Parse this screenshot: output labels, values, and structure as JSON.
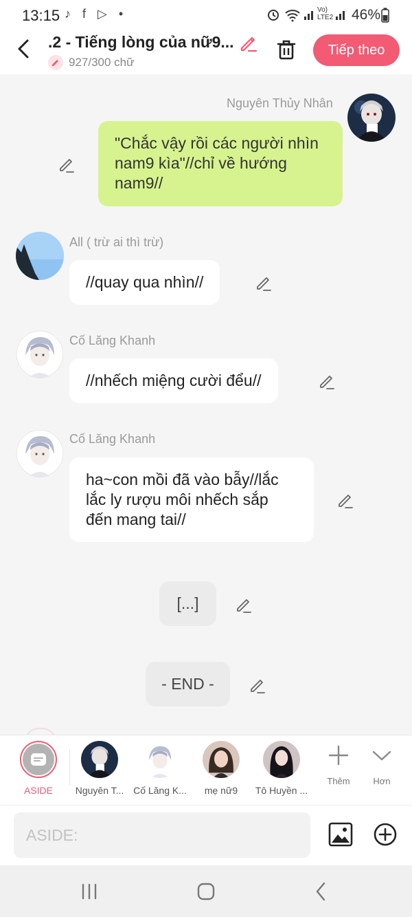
{
  "status": {
    "time": "13:15",
    "left_icons": "♪ f ▷ •",
    "signal_text": "Vo)\nLTE2",
    "battery": "46%"
  },
  "header": {
    "title": ".2 - Tiếng lòng của nữ9...",
    "word_count": "927/300 chữ",
    "next_label": "Tiếp theo"
  },
  "messages": [
    {
      "name": "Nguyên Thủy Nhân",
      "text": "\"Chắc vậy rồi các người nhìn nam9 kìa\"//chỉ về hướng nam9//"
    },
    {
      "name": "All ( trừ ai thì trừ)",
      "text": "//quay qua nhìn//"
    },
    {
      "name": "Cố Lăng Khanh",
      "text": "//nhếch miệng cười đểu//"
    },
    {
      "name": "Cố Lăng Khanh",
      "text": "ha~con mồi đã vào bẫy//lắc lắc ly rượu môi nhếch sắp đến mang tai//"
    },
    {
      "text": "[...]"
    },
    {
      "text": "- END -"
    }
  ],
  "characters": [
    {
      "label": "ASIDE",
      "color": "#f35a73"
    },
    {
      "label": "Nguyên T..."
    },
    {
      "label": "Cố Lăng K..."
    },
    {
      "label": "mẹ nữ9"
    },
    {
      "label": "Tô Huyền ..."
    }
  ],
  "tools": {
    "more": "Thêm",
    "expand": "Hơn"
  },
  "input": {
    "placeholder": "ASIDE:"
  },
  "colors": {
    "accent": "#f35a73",
    "green_bubble": "#d7f38f",
    "background": "#f5f5f5"
  }
}
